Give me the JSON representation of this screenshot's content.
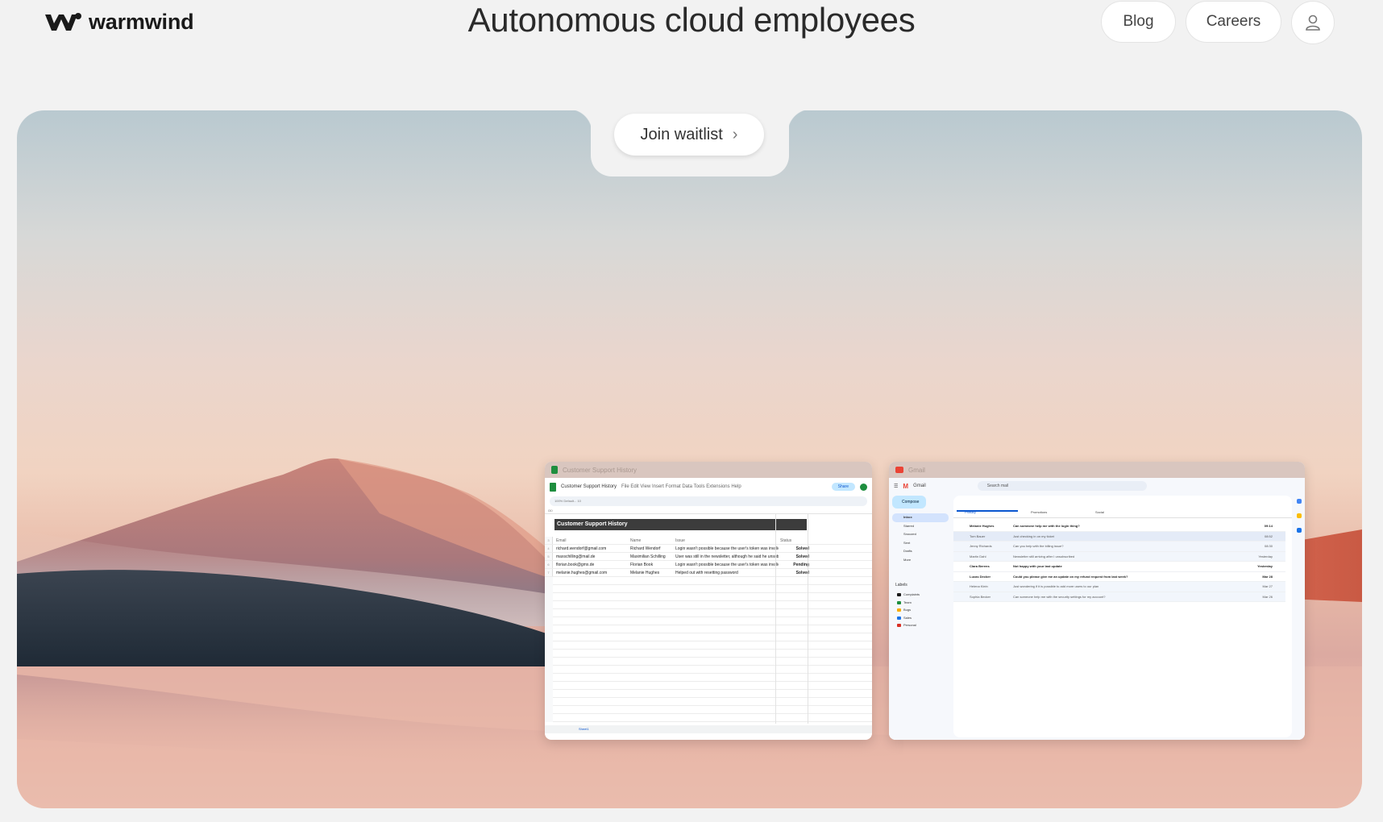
{
  "header": {
    "brand": "warmwind",
    "headline": "Autonomous cloud employees",
    "nav": {
      "blog": "Blog",
      "careers": "Careers"
    }
  },
  "hero": {
    "cta": "Join waitlist",
    "cta_icon": "chevron-right-icon"
  },
  "sheets_window": {
    "app_icon": "google-sheets-icon",
    "doc_title": "Customer Support History",
    "menu": [
      "File",
      "Edit",
      "View",
      "Insert",
      "Format",
      "Data",
      "Tools",
      "Extensions",
      "Help"
    ],
    "share": "Share",
    "toolbar": "100%   Default...   10",
    "cell_ref": "I30",
    "sheet_heading": "Customer Support History",
    "columns": [
      "Email",
      "Name",
      "Issue",
      "Status"
    ],
    "rows": [
      [
        "richard.wendorf@gmail.com",
        "Richard Wendorf",
        "Login wasn't possible because the user's token was invalid",
        "Solved"
      ],
      [
        "maxschilling@mail.de",
        "Maximilian Schilling",
        "User was still in the newsletter, although he said he unsubscribed",
        "Solved"
      ],
      [
        "florian.book@gmx.de",
        "Florian Book",
        "Login wasn't possible because the user's token was invalid",
        "Pending"
      ],
      [
        "melanie.hughes@gmail.com",
        "Melanie Hughes",
        "Helped out with resetting password",
        "Solved"
      ]
    ],
    "sheet_tab": "Sheet1"
  },
  "gmail_window": {
    "app_icon": "gmail-icon",
    "app_name": "Gmail",
    "search_placeholder": "Search mail",
    "compose": "Compose",
    "nav": [
      "Inbox",
      "Starred",
      "Snoozed",
      "Sent",
      "Drafts",
      "More"
    ],
    "labels_heading": "Labels",
    "labels": [
      {
        "name": "Complaints",
        "color": "#1a1a1a"
      },
      {
        "name": "Team",
        "color": "#1e8e3e"
      },
      {
        "name": "Bugs",
        "color": "#f9ab00"
      },
      {
        "name": "Sales",
        "color": "#1a73e8"
      },
      {
        "name": "Personal",
        "color": "#d93025"
      }
    ],
    "tabs": [
      "Primary",
      "Promotions",
      "Social"
    ],
    "emails": [
      {
        "from": "Melanie Hughes",
        "subject": "Can someone help me with the login thing?",
        "date": "09:14"
      },
      {
        "from": "Tom Bauer",
        "subject": "Just checking in on my ticket",
        "date": "08:52"
      },
      {
        "from": "Jenny Richards",
        "subject": "Can you help with the billing issue?",
        "date": "08:30"
      },
      {
        "from": "Martin Dahl",
        "subject": "Newsletter still arriving after I unsubscribed",
        "date": "Yesterday"
      },
      {
        "from": "Clara Berens",
        "subject": "Not happy with your last update",
        "date": "Yesterday"
      },
      {
        "from": "Lucas Decker",
        "subject": "Could you please give me an update on my refund request from last week?",
        "date": "Mar 28"
      },
      {
        "from": "Helena Klein",
        "subject": "Just wondering if it is possible to add more users to our plan",
        "date": "Mar 27"
      },
      {
        "from": "Sophia Becker",
        "subject": "Can someone help me with the security settings for my account?",
        "date": "Mar 26"
      }
    ]
  },
  "colors": {
    "page_bg": "#f2f2f2",
    "sheets_green": "#1e8e3e",
    "gmail_red": "#ea4335",
    "link_blue": "#0b57d0"
  }
}
